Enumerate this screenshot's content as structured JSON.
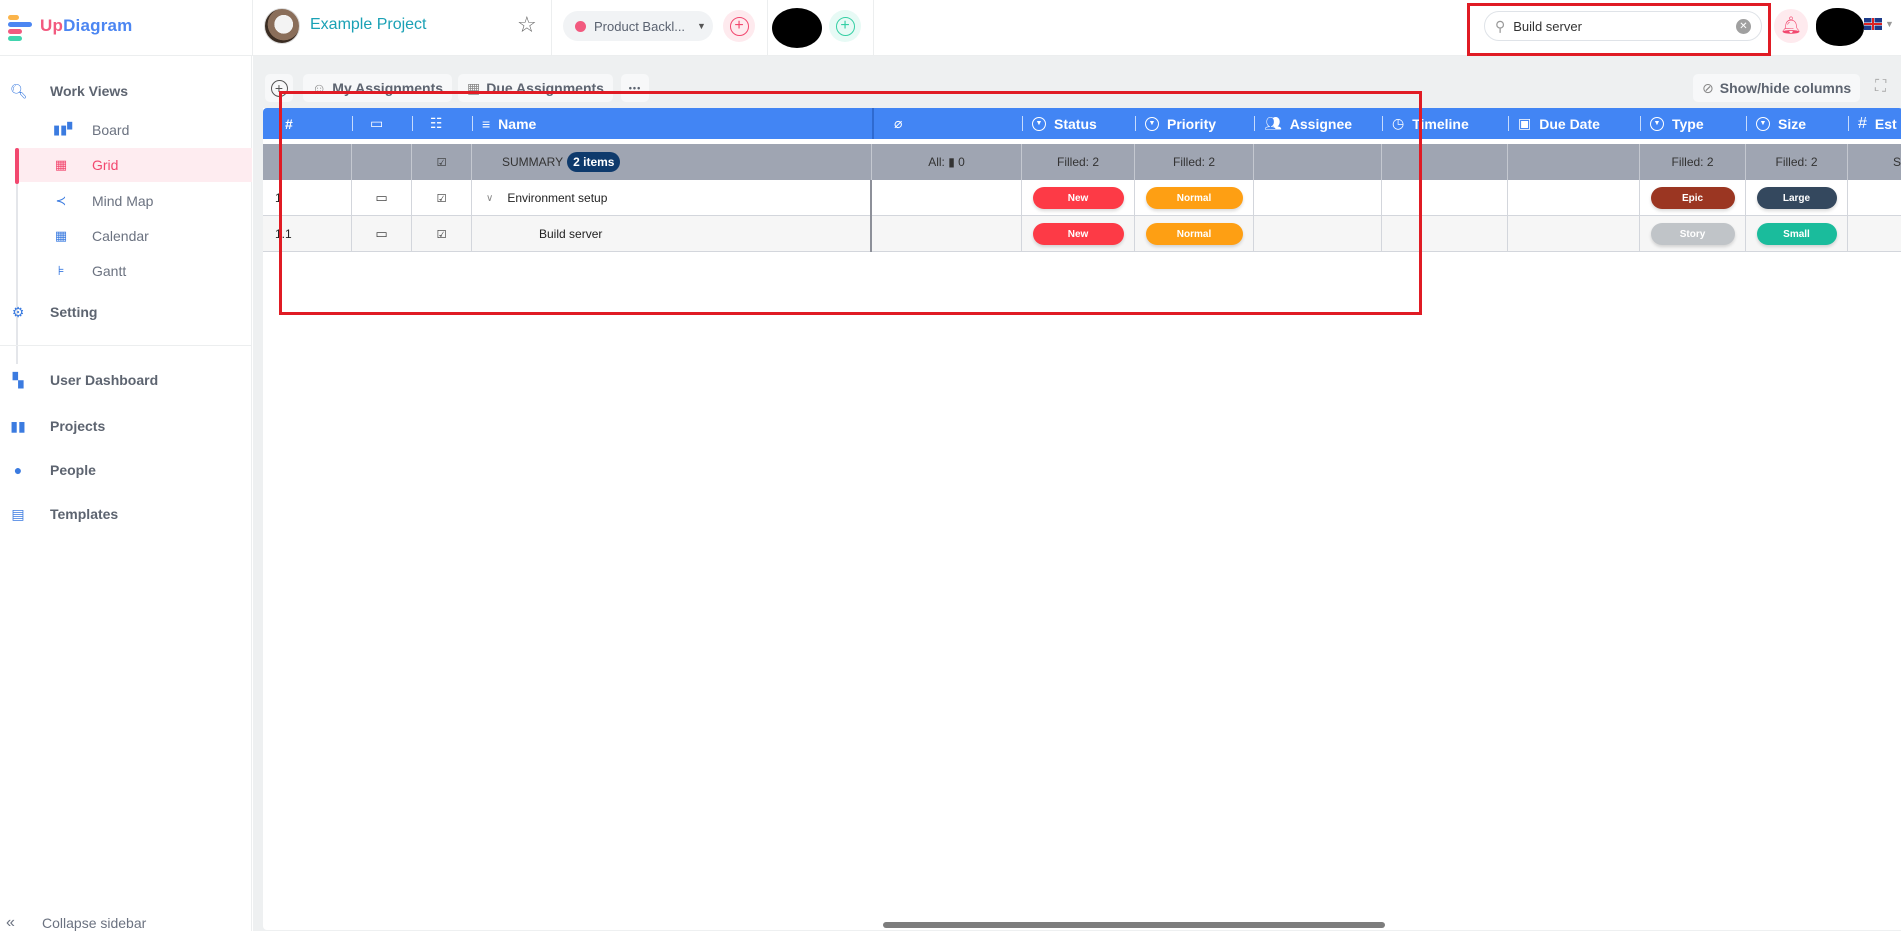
{
  "app": {
    "logo_up": "Up",
    "logo_diagram": "Diagram",
    "colors": {
      "brand_pink": "#f25a7f",
      "brand_blue": "#4c86f2",
      "accent_teal": "#1aa1b5",
      "header_blue": "#4285f4"
    }
  },
  "header": {
    "project_name": "Example Project",
    "star_icon": "star-outline-icon",
    "backlog_label": "Product Backl...",
    "search_value": "Build server",
    "search_placeholder": "Search"
  },
  "sidebar": {
    "work_views": "Work Views",
    "sub_items": [
      {
        "label": "Board",
        "icon": "board-icon"
      },
      {
        "label": "Grid",
        "icon": "grid-icon",
        "active": true
      },
      {
        "label": "Mind Map",
        "icon": "mind-map-icon"
      },
      {
        "label": "Calendar",
        "icon": "calendar-icon"
      },
      {
        "label": "Gantt",
        "icon": "gantt-icon"
      }
    ],
    "setting": "Setting",
    "user_dashboard": "User Dashboard",
    "projects": "Projects",
    "people": "People",
    "templates": "Templates",
    "collapse": "Collapse sidebar"
  },
  "toolbar": {
    "my_assignments": "My Assignments",
    "due_assignments": "Due Assignments",
    "more": "•••",
    "show_hide": "Show/hide columns"
  },
  "grid": {
    "columns": {
      "number": "#",
      "name": "Name",
      "status": "Status",
      "priority": "Priority",
      "assignee": "Assignee",
      "timeline": "Timeline",
      "due_date": "Due Date",
      "type": "Type",
      "size": "Size",
      "estimate": "Est"
    },
    "summary": {
      "label": "SUMMARY",
      "items_badge": "2 items",
      "attachments": "All: ▮ 0",
      "status": "Filled: 2",
      "priority": "Filled: 2",
      "type": "Filled: 2",
      "size": "Filled: 2",
      "estimate": "S"
    },
    "rows": [
      {
        "number": "1",
        "name": "Environment setup",
        "status": {
          "label": "New",
          "color": "#fd3a46"
        },
        "priority": {
          "label": "Normal",
          "color": "#fe9f13"
        },
        "type": {
          "label": "Epic",
          "color": "#9b3622"
        },
        "size": {
          "label": "Large",
          "color": "#34485e"
        }
      },
      {
        "number": "1.1",
        "name": "Build server",
        "status": {
          "label": "New",
          "color": "#fd3a46"
        },
        "priority": {
          "label": "Normal",
          "color": "#fe9f13"
        },
        "type": {
          "label": "Story",
          "color": "#c0c4c8"
        },
        "size": {
          "label": "Small",
          "color": "#1abc9c"
        }
      }
    ]
  }
}
